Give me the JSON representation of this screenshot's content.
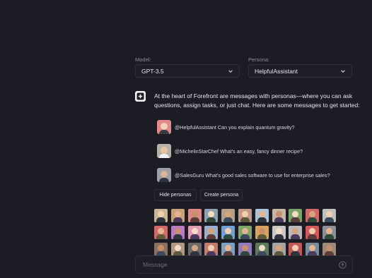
{
  "model": {
    "label": "Model:",
    "value": "GPT-3.5"
  },
  "persona": {
    "label": "Persona:",
    "value": "HelpfulAssistant"
  },
  "intro": {
    "text": "At the heart of Forefront are messages with personas—where you can ask questions, assign tasks, or just chat. Here are some messages to get started:"
  },
  "suggestions": [
    {
      "text": "@HelpfulAssistant Can you explain quantum gravity?",
      "avatar_color": "#e58a8a"
    },
    {
      "text": "@MichelinStarChef What's an easy, fancy dinner recipe?",
      "avatar_color": "#b8b1a8"
    },
    {
      "text": "@SalesGuru What's good sales software to use for enterprise sales?",
      "avatar_color": "#9aa0a6"
    }
  ],
  "buttons": {
    "hide_personas": "Hide personas",
    "create_persona": "Create persona"
  },
  "persona_tiles": [
    "#c9b69a",
    "#c7a27a",
    "#d98a86",
    "#8fa0b3",
    "#b5a08a",
    "#c49a86",
    "#a9c4d9",
    "#c4b8a4",
    "#7aa36a",
    "#d06a6a",
    "#bfbfbf",
    "#d16a6a",
    "#b67bc2",
    "#e09ab4",
    "#9ab0d1",
    "#6fa0d9",
    "#7da86a",
    "#d9a45a",
    "#c8c8c8",
    "#b9b9b9",
    "#d45a5a",
    "#8a8f99",
    "#8a7060",
    "#b09a86",
    "#6a6a6a",
    "#c77a6a",
    "#7aa0c2",
    "#8e7bc2",
    "#5a7a5a",
    "#a4a4a4",
    "#c05a5a",
    "#7a8a9a",
    "#9a8a7a"
  ],
  "composer": {
    "placeholder": "Message"
  }
}
